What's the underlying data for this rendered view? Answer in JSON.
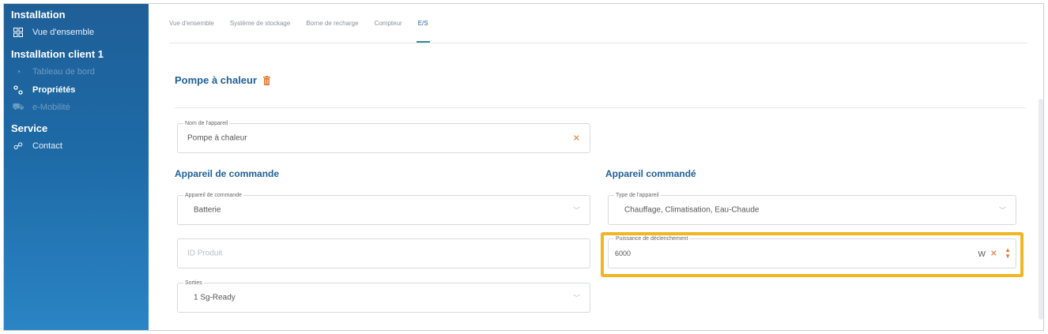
{
  "sidebar": {
    "sections": [
      {
        "title": "Installation",
        "items": [
          {
            "label": "Vue d'ensemble",
            "icon": "grid-icon",
            "state": "normal"
          }
        ]
      },
      {
        "title": "Installation client 1",
        "items": [
          {
            "label": "Tableau de bord",
            "icon": "dashboard-icon",
            "state": "disabled"
          },
          {
            "label": "Propriétés",
            "icon": "properties-icon",
            "state": "active"
          },
          {
            "label": "e-Mobilité",
            "icon": "car-icon",
            "state": "disabled"
          }
        ]
      },
      {
        "title": "Service",
        "items": [
          {
            "label": "Contact",
            "icon": "contact-icon",
            "state": "normal"
          }
        ]
      }
    ]
  },
  "tabs": [
    "Vue d'ensemble",
    "Système de stockage",
    "Borne de recharge",
    "Compteur",
    "E/S"
  ],
  "active_tab": "E/S",
  "page": {
    "title": "Pompe à chaleur",
    "delete_icon": "trash-icon"
  },
  "device_name": {
    "label": "Nom de l'appareil",
    "value": "Pompe à chaleur"
  },
  "controller": {
    "heading": "Appareil de commande",
    "device": {
      "label": "Appareil de commande",
      "value": "Batterie"
    },
    "product_id": {
      "placeholder": "ID Produit"
    },
    "outputs": {
      "label": "Sorties",
      "value": "1 Sg-Ready"
    }
  },
  "controlled": {
    "heading": "Appareil commandé",
    "type": {
      "label": "Type de l'appareil",
      "value": "Chauffage, Climatisation, Eau-Chaude"
    },
    "trigger_power": {
      "label": "Puissance de déclenchement",
      "value": "6000",
      "unit": "W"
    }
  },
  "colors": {
    "sidebar": "#1f5f98",
    "accent": "#1f5f98",
    "clear": "#e07a2e",
    "highlight": "#f0b623"
  }
}
